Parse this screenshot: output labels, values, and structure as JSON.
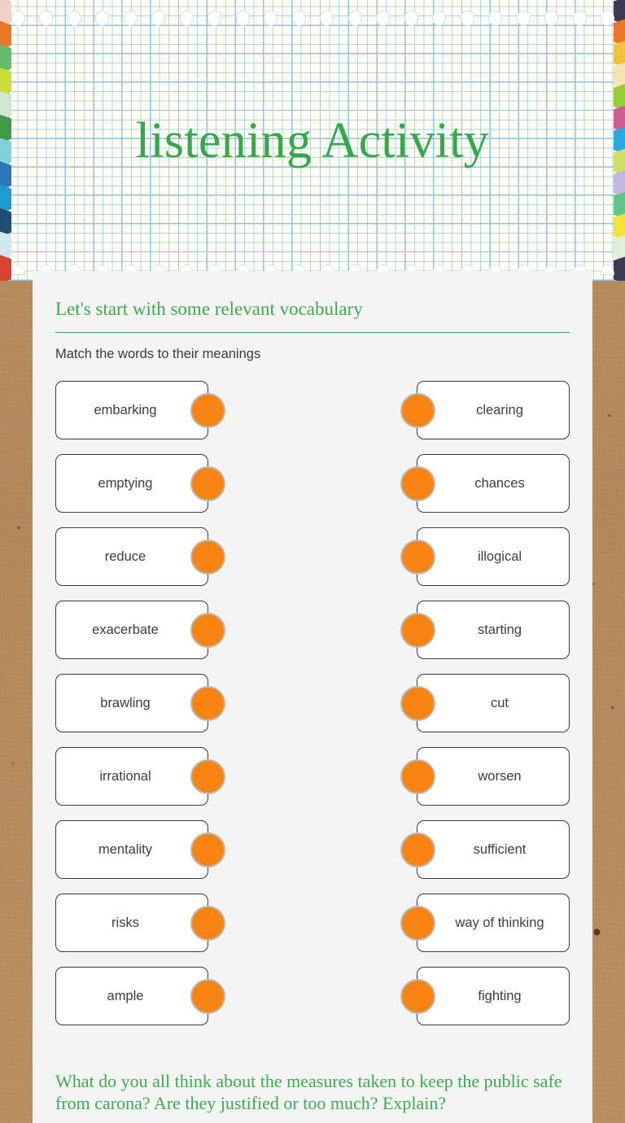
{
  "header": {
    "title": "listening Activity",
    "hole_count": 22,
    "paper_style": "graph-paper",
    "stripe_colors_left": [
      "#f3cfc4",
      "#e87826",
      "#67b96b",
      "#cddb3b",
      "#cfe6d2",
      "#3f9b4a",
      "#7fd2d8",
      "#2d77b8",
      "#1f9bd2",
      "#1d4f76",
      "#cfe9ef",
      "#d6452f"
    ],
    "stripe_colors_right": [
      "#3d3a52",
      "#e87826",
      "#f2c13c",
      "#f6e3b0",
      "#9acb3c",
      "#d05d8e",
      "#2aa9df",
      "#cfe06a",
      "#c3b7e2",
      "#62c48b",
      "#f4e23c",
      "#dff0d6",
      "#3d3a52"
    ]
  },
  "section": {
    "heading": "Let's start with some relevant vocabulary",
    "instructions": "Match the words to their meanings"
  },
  "match_rows": [
    {
      "left": "embarking",
      "right": "clearing"
    },
    {
      "left": "emptying",
      "right": "chances"
    },
    {
      "left": "reduce",
      "right": "illogical"
    },
    {
      "left": "exacerbate",
      "right": "starting"
    },
    {
      "left": "brawling",
      "right": "cut"
    },
    {
      "left": "irrational",
      "right": "worsen"
    },
    {
      "left": "mentality",
      "right": "sufficient"
    },
    {
      "left": "risks",
      "right": "way of thinking"
    },
    {
      "left": "ample",
      "right": "fighting"
    }
  ],
  "closing_prompt": "What do you all think about the measures taken to keep the public safe from carona? Are they justified or too much? Explain?",
  "colors": {
    "green": "#3cab4e",
    "title_green": "#34a84a",
    "knob_orange": "#f98412",
    "knob_ring": "#b9b9b9",
    "card_bg": "#f4f4f4",
    "kraft": "#b5895a",
    "paper": "#fdfdf3",
    "grid_line": "#78b8d4"
  }
}
